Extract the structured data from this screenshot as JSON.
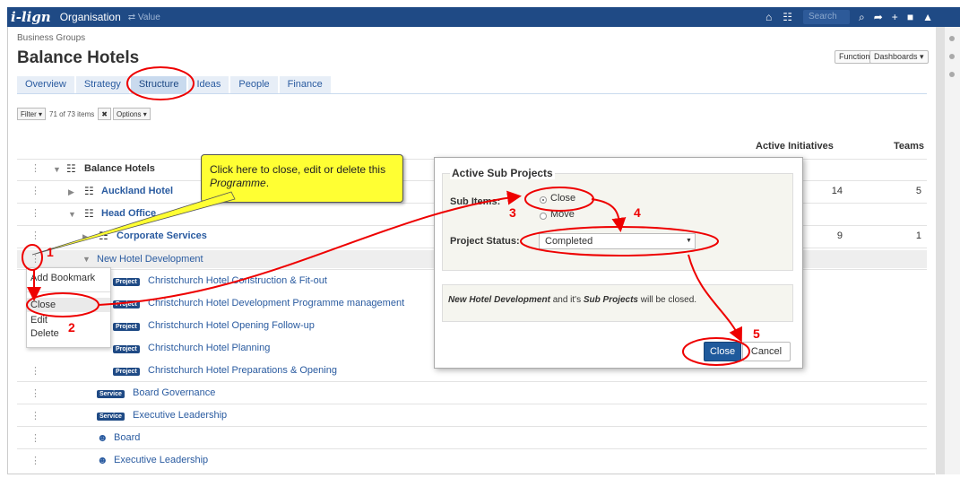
{
  "topbar": {
    "logo": "i-lign",
    "org_label": "Organisation",
    "value_label": "⇄ Value",
    "search_placeholder": "Search",
    "home_icon": "⌂",
    "hierarchy_icon": "☷",
    "search_icon": "⌕",
    "share_icon": "➦",
    "add_icon": "+",
    "bookmark_icon": "■",
    "bell_icon": "▲"
  },
  "breadcrumb": "Business Groups",
  "page_title": "Balance Hotels",
  "functions_label": "Functions ▾",
  "dashboards_label": "Dashboards ▾",
  "tabs": [
    "Overview",
    "Strategy",
    "Structure",
    "Ideas",
    "People",
    "Finance"
  ],
  "filter": {
    "filter_label": "Filter ▾",
    "count_text": "71 of 73 items",
    "clear_label": "✖",
    "options_label": "Options ▾"
  },
  "columns": {
    "active_initiatives": "Active Initiatives",
    "teams": "Teams"
  },
  "rows": [
    {
      "label": "Balance Hotels"
    },
    {
      "label": "Auckland Hotel",
      "initiatives": "14",
      "teams": "5"
    },
    {
      "label": "Head Office"
    },
    {
      "label": "Corporate Services",
      "initiatives": "9",
      "teams": "1"
    },
    {
      "label": "New Hotel Development"
    },
    {
      "label": "Christchurch Hotel Construction & Fit-out",
      "badge": "Project"
    },
    {
      "label": "Christchurch Hotel Development Programme management",
      "badge": "Project"
    },
    {
      "label": "Christchurch Hotel Opening Follow-up",
      "badge": "Project"
    },
    {
      "label": "Christchurch Hotel Planning",
      "badge": "Project"
    },
    {
      "label": "Christchurch Hotel Preparations & Opening",
      "badge": "Project"
    },
    {
      "label": "Board Governance",
      "badge": "Service"
    },
    {
      "label": "Executive Leadership",
      "badge": "Service"
    },
    {
      "label": "Board"
    },
    {
      "label": "Executive Leadership"
    }
  ],
  "context_menu": {
    "add_bookmark": "Add Bookmark",
    "close": "Close",
    "edit": "Edit",
    "delete": "Delete"
  },
  "callout": {
    "text_before": "Click here to close, edit or delete this ",
    "emphasis": "Programme",
    "text_after": "."
  },
  "modal": {
    "legend": "Active Sub Projects",
    "sub_items_label": "Sub Items:",
    "option_close": "Close",
    "option_move": "Move",
    "status_label": "Project Status:",
    "status_value": "Completed",
    "info_subject": "New Hotel Development",
    "info_middle": " and it's ",
    "info_object": "Sub Projects",
    "info_end": " will be closed.",
    "close_button": "Close",
    "cancel_button": "Cancel"
  },
  "annotations": [
    "1",
    "2",
    "3",
    "4",
    "5"
  ],
  "colors": {
    "brand_blue": "#1f4a85",
    "link_blue": "#2a5ba0",
    "annotation_red": "#e00000",
    "callout_yellow": "#ffff33"
  }
}
